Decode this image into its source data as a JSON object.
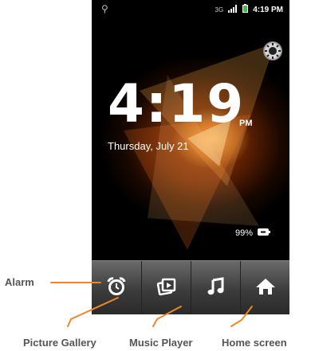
{
  "statusbar": {
    "time": "4:19 PM"
  },
  "lockscreen": {
    "time": "4:19",
    "ampm": "PM",
    "date": "Thursday, July 21",
    "battery": "99%"
  },
  "dock": {
    "items": [
      {
        "icon": "alarm-clock-icon"
      },
      {
        "icon": "picture-gallery-icon"
      },
      {
        "icon": "music-note-icon"
      },
      {
        "icon": "home-icon"
      }
    ]
  },
  "callouts": {
    "alarm": "Alarm",
    "picture_gallery": "Picture Gallery",
    "music_player": "Music Player",
    "home_screen": "Home screen"
  },
  "colors": {
    "callout_line": "#f0852a",
    "callout_text": "#555555"
  }
}
